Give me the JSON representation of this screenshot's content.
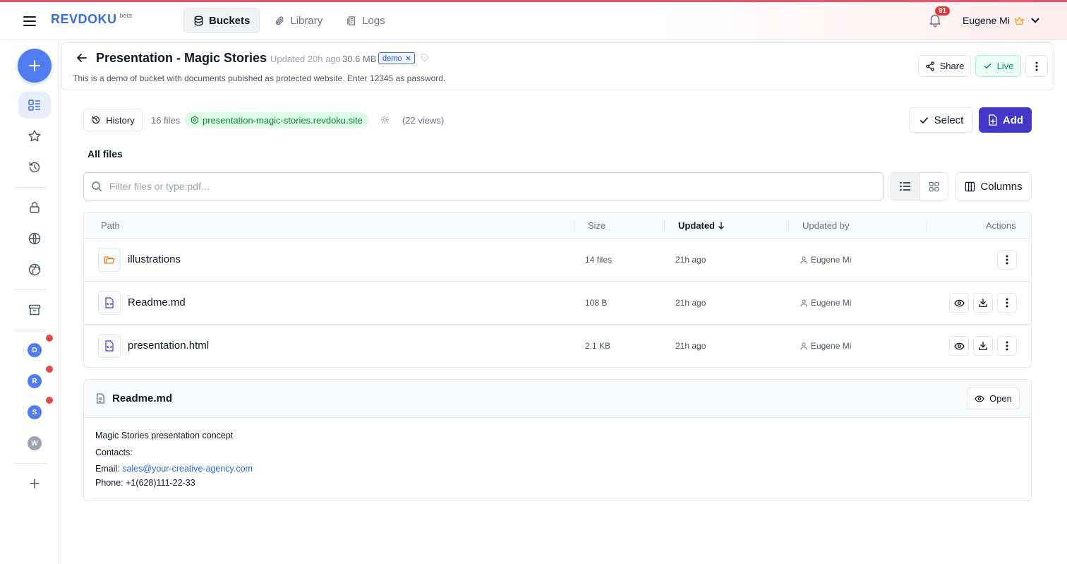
{
  "app": {
    "logo": "REVDOKU",
    "logo_badge": "beta",
    "nav": [
      {
        "label": "Buckets",
        "icon": "database-icon",
        "active": true
      },
      {
        "label": "Library",
        "icon": "paperclip-icon",
        "active": false
      },
      {
        "label": "Logs",
        "icon": "logs-icon",
        "active": false
      }
    ],
    "notifications_count": "91",
    "user_name": "Eugene Mi",
    "accent_color": "#4338ca",
    "brand_color": "#3b6fd8"
  },
  "sidebar": {
    "avatars": [
      {
        "letter": "D",
        "color": "#4f7df0",
        "unread": true
      },
      {
        "letter": "R",
        "color": "#4f7df0",
        "unread": true
      },
      {
        "letter": "S",
        "color": "#4f7df0",
        "unread": true
      },
      {
        "letter": "W",
        "color": "#9ca3af",
        "unread": false
      }
    ]
  },
  "bucket": {
    "title": "Presentation - Magic Stories",
    "updated": "Updated 20h ago",
    "size": "30.6 MB",
    "tag": "demo",
    "description": "This is a demo of bucket with documents pubished as protected website. Enter 12345 as password.",
    "share_label": "Share",
    "live_label": "Live"
  },
  "toolbar": {
    "history_label": "History",
    "file_count": "16 files",
    "site_url": "presentation-magic-stories.revdoku.site",
    "views": "(22 views)",
    "select_label": "Select",
    "add_label": "Add"
  },
  "files": {
    "section_title": "All files",
    "search_placeholder": "Filter files or type:pdf...",
    "columns_label": "Columns",
    "headers": {
      "path": "Path",
      "size": "Size",
      "updated": "Updated",
      "updated_by": "Updated by",
      "actions": "Actions"
    },
    "rows": [
      {
        "name": "illustrations",
        "type": "folder",
        "size": "14 files",
        "updated": "21h ago",
        "updated_by": "Eugene Mi"
      },
      {
        "name": "Readme.md",
        "type": "file",
        "size": "108 B",
        "updated": "21h ago",
        "updated_by": "Eugene Mi"
      },
      {
        "name": "presentation.html",
        "type": "file",
        "size": "2.1 KB",
        "updated": "21h ago",
        "updated_by": "Eugene Mi"
      }
    ]
  },
  "preview": {
    "title": "Readme.md",
    "open_label": "Open",
    "line1": "Magic Stories presentation concept",
    "line2": "Contacts:",
    "email_label": "Email:",
    "email": "sales@your-creative-agency.com",
    "phone": "Phone: +1(628)111-22-33"
  }
}
